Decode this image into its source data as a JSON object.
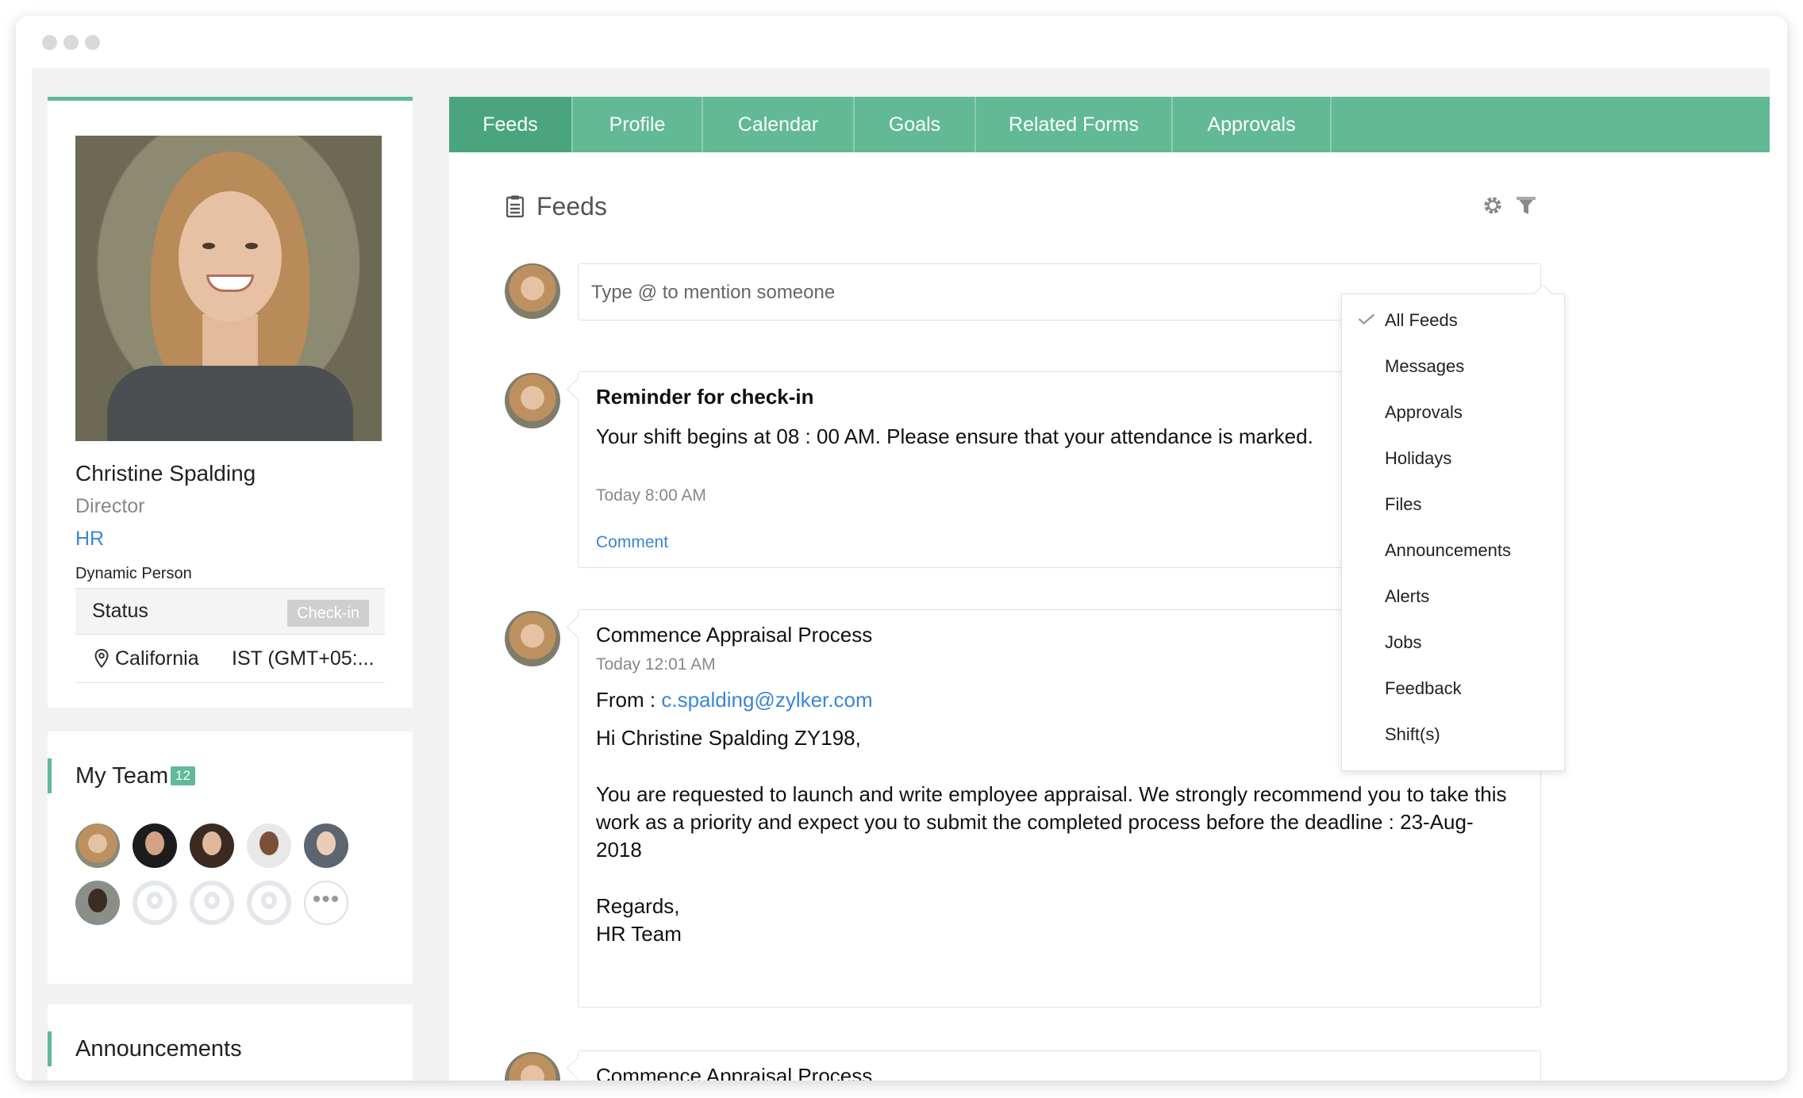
{
  "colors": {
    "accent": "#5fba97",
    "link": "#3a86d4",
    "muted": "#888888"
  },
  "tabs": [
    "Feeds",
    "Profile",
    "Calendar",
    "Goals",
    "Related Forms",
    "Approvals"
  ],
  "profile": {
    "name": "Christine Spalding",
    "role": "Director",
    "department": "HR",
    "tag": "Dynamic Person",
    "status_label": "Status",
    "checkin_label": "Check-in",
    "location": "California",
    "timezone": "IST (GMT+05:..."
  },
  "team": {
    "title": "My Team",
    "count": "12",
    "more_label": "•••"
  },
  "announcements": {
    "title": "Announcements"
  },
  "feeds": {
    "title": "Feeds",
    "mention_placeholder": "Type @ to mention someone",
    "posts": [
      {
        "title": "Reminder for check-in",
        "body": "Your shift begins at 08 : 00 AM. Please ensure that your attendance is marked.",
        "time": "Today 8:00 AM",
        "action": "Comment"
      },
      {
        "title": "Commence Appraisal Process",
        "time": "Today 12:01 AM",
        "from_label": "From :",
        "from_email": "c.spalding@zylker.com",
        "greeting": "Hi Christine Spalding ZY198,",
        "body_line1": "You are requested to launch and write employee appraisal. We strongly recommend you to take this",
        "body_line2": "work as a priority and expect you to submit the completed process before the deadline : 23-Aug-",
        "body_line3": "2018",
        "signoff": "Regards,",
        "signature": "HR Team"
      },
      {
        "title": "Commence Appraisal Process"
      }
    ]
  },
  "filter_menu": {
    "selected": "All Feeds",
    "items": [
      "All Feeds",
      "Messages",
      "Approvals",
      "Holidays",
      "Files",
      "Announcements",
      "Alerts",
      "Jobs",
      "Feedback",
      "Shift(s)"
    ]
  }
}
